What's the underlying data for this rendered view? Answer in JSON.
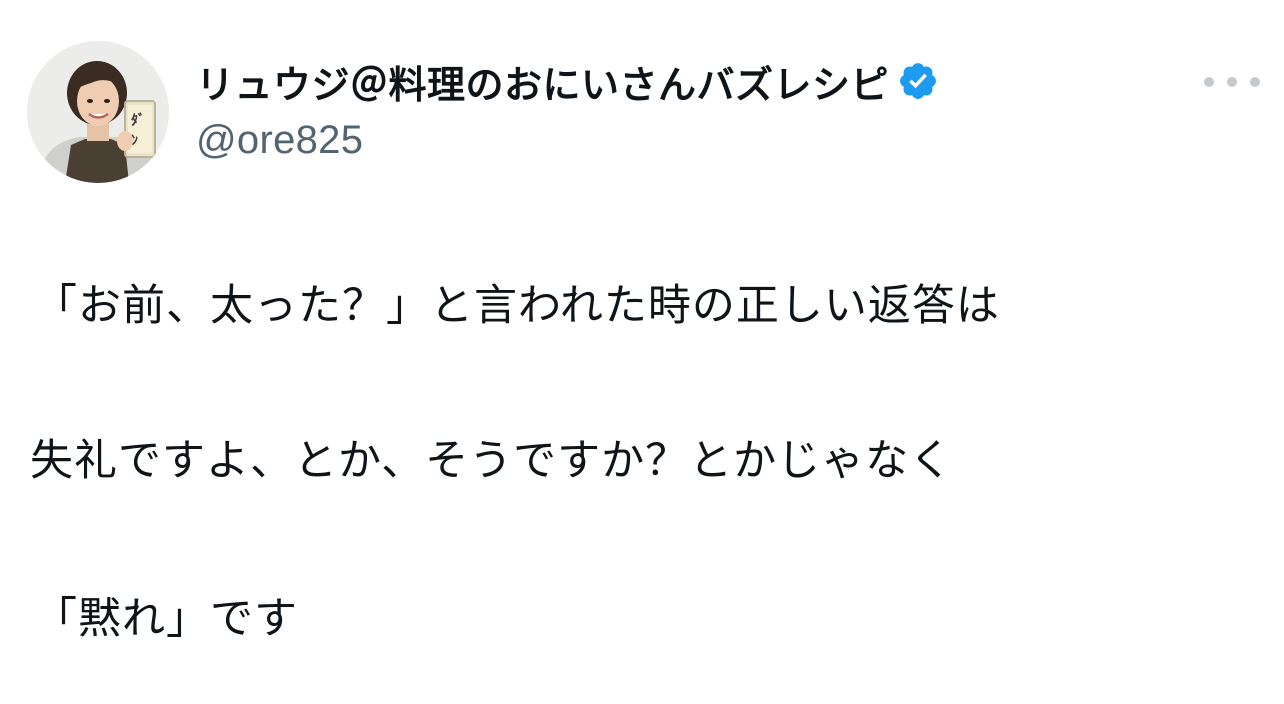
{
  "author": {
    "display_name": "リュウジ＠料理のおにいさんバズレシピ",
    "handle": "@ore825",
    "verified": true
  },
  "more_menu_icon": "more-horizontal-icon",
  "tweet": {
    "lines": [
      "「お前、太った？」と言われた時の正しい返答は",
      "失礼ですよ、とか、そうですか？とかじゃなく",
      "「黙れ」です"
    ]
  },
  "colors": {
    "text": "#0f1419",
    "handle": "#536471",
    "verified_badge": "#1d9bf0",
    "background": "#ffffff"
  }
}
